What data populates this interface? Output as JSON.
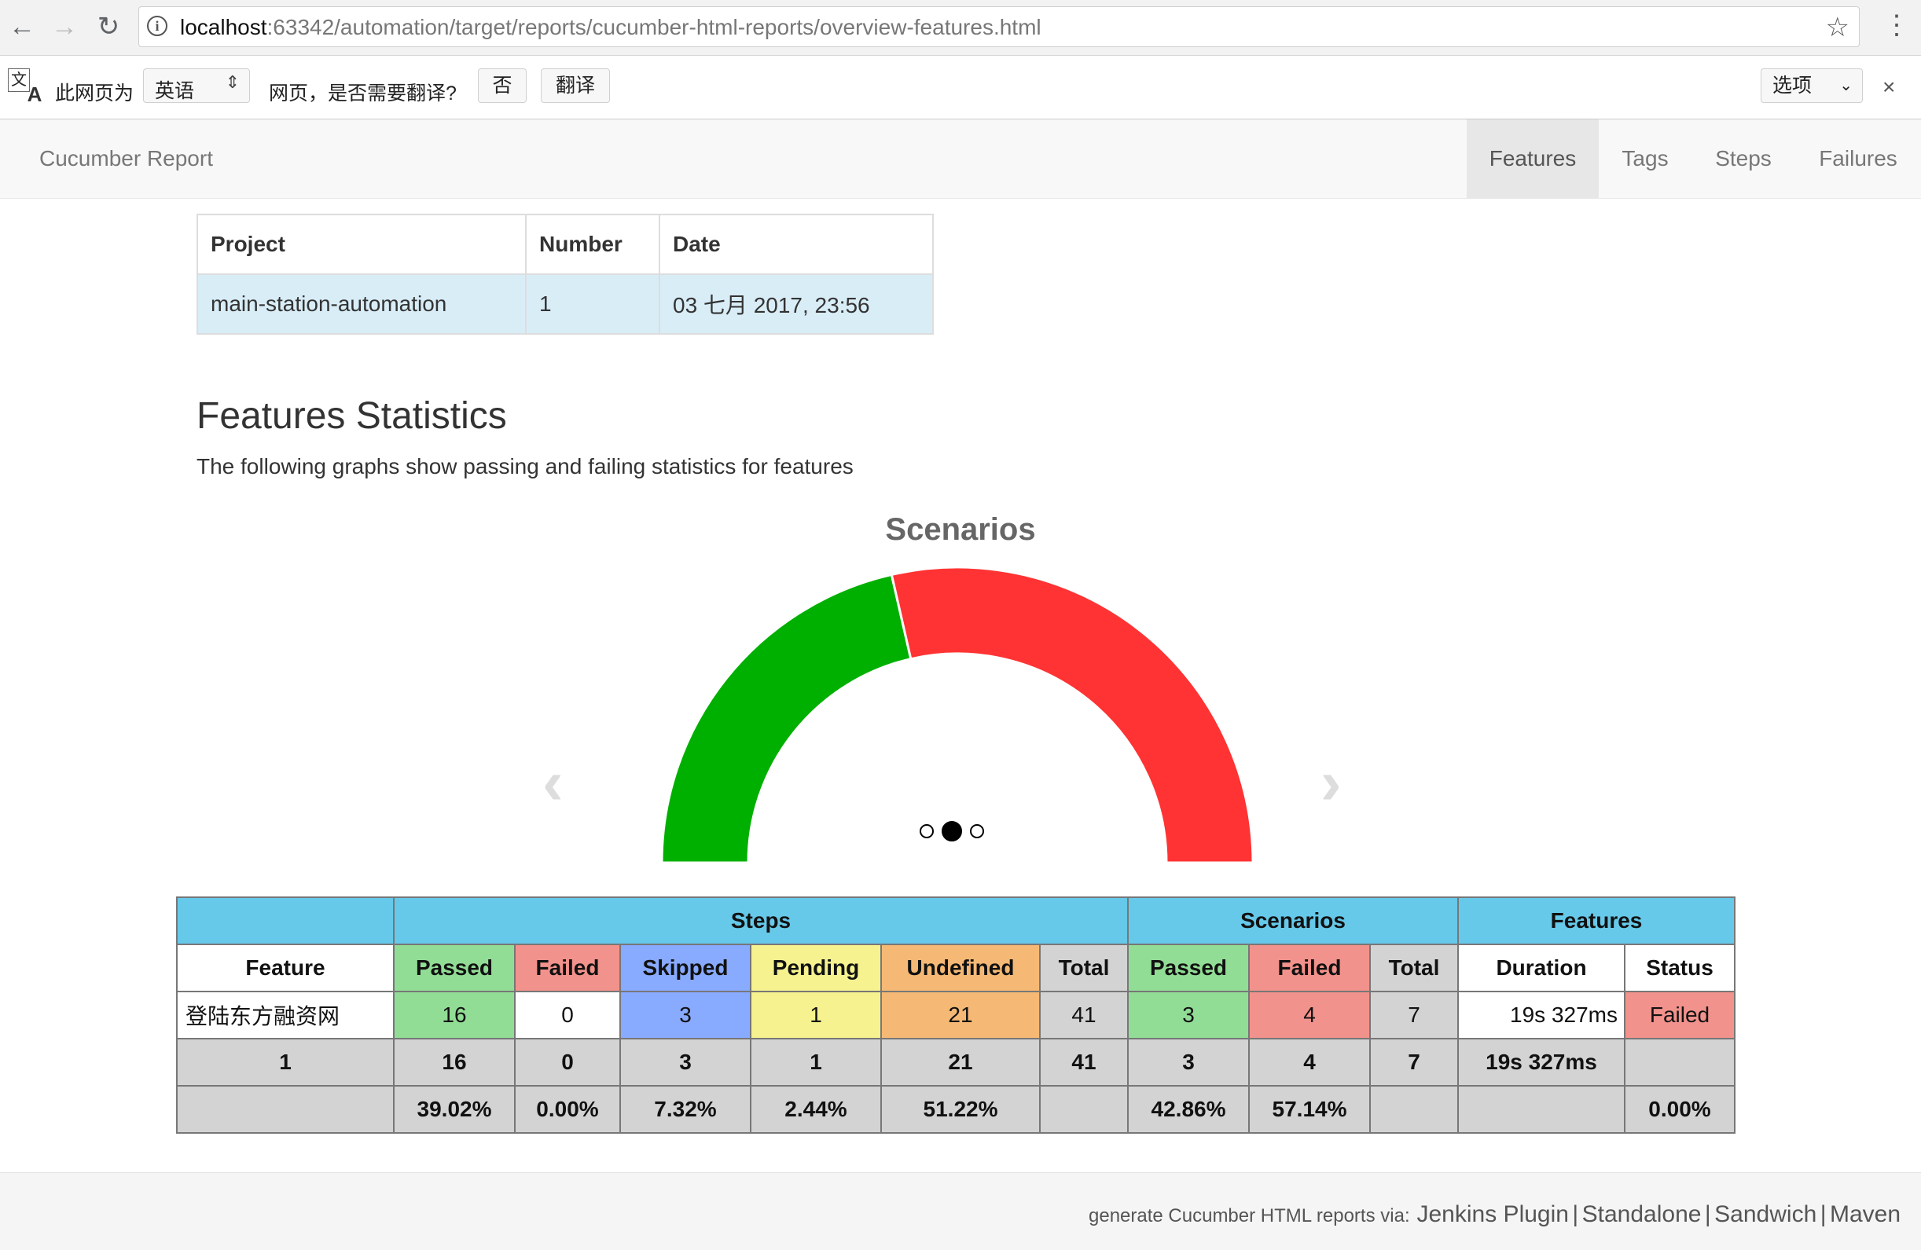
{
  "browser": {
    "url_host": "localhost",
    "url_rest": ":63342/automation/target/reports/cucumber-html-reports/overview-features.html"
  },
  "translate_bar": {
    "icon_a": "文",
    "icon_b": "A",
    "text_prefix": "此网页为",
    "language": "英语",
    "question": "网页，是否需要翻译?",
    "no_button": "否",
    "translate_button": "翻译",
    "options": "选项"
  },
  "nav": {
    "brand": "Cucumber Report",
    "items": [
      "Features",
      "Tags",
      "Steps",
      "Failures"
    ],
    "active": "Features"
  },
  "info_table": {
    "headers": [
      "Project",
      "Number",
      "Date"
    ],
    "row": [
      "main-station-automation",
      "1",
      "03 七月 2017, 23:56"
    ]
  },
  "page": {
    "title": "Features Statistics",
    "subtitle": "The following graphs show passing and failing statistics for features"
  },
  "chart_data": {
    "type": "pie",
    "title": "Scenarios",
    "categories": [
      "Passed",
      "Failed"
    ],
    "values": [
      3,
      4
    ],
    "colors": [
      "#00b000",
      "#ff3333"
    ]
  },
  "carousel": {
    "slide_count": 3,
    "active_index": 1
  },
  "stats_table": {
    "groups": [
      "",
      "Steps",
      "Scenarios",
      "Features"
    ],
    "columns": [
      "Feature",
      "Passed",
      "Failed",
      "Skipped",
      "Pending",
      "Undefined",
      "Total",
      "Passed",
      "Failed",
      "Total",
      "Duration",
      "Status"
    ],
    "column_colors": [
      "#ffffff",
      "#92dd96",
      "#f2928c",
      "#88aaff",
      "#f5f28f",
      "#f5b975",
      "#d3d3d3",
      "#92dd96",
      "#f2928c",
      "#d3d3d3",
      "#ffffff",
      "#ffffff"
    ],
    "row": [
      "登陆东方融资网",
      "16",
      "0",
      "3",
      "1",
      "21",
      "41",
      "3",
      "4",
      "7",
      "19s 327ms",
      "Failed"
    ],
    "totals": [
      "1",
      "16",
      "0",
      "3",
      "1",
      "21",
      "41",
      "3",
      "4",
      "7",
      "19s 327ms",
      ""
    ],
    "percentages": [
      "",
      "39.02%",
      "0.00%",
      "7.32%",
      "2.44%",
      "51.22%",
      "",
      "42.86%",
      "57.14%",
      "",
      "",
      "0.00%"
    ]
  },
  "footer": {
    "label": "generate Cucumber HTML reports via:",
    "links": [
      "Jenkins Plugin",
      "Standalone",
      "Sandwich",
      "Maven"
    ],
    "separator": "|"
  }
}
